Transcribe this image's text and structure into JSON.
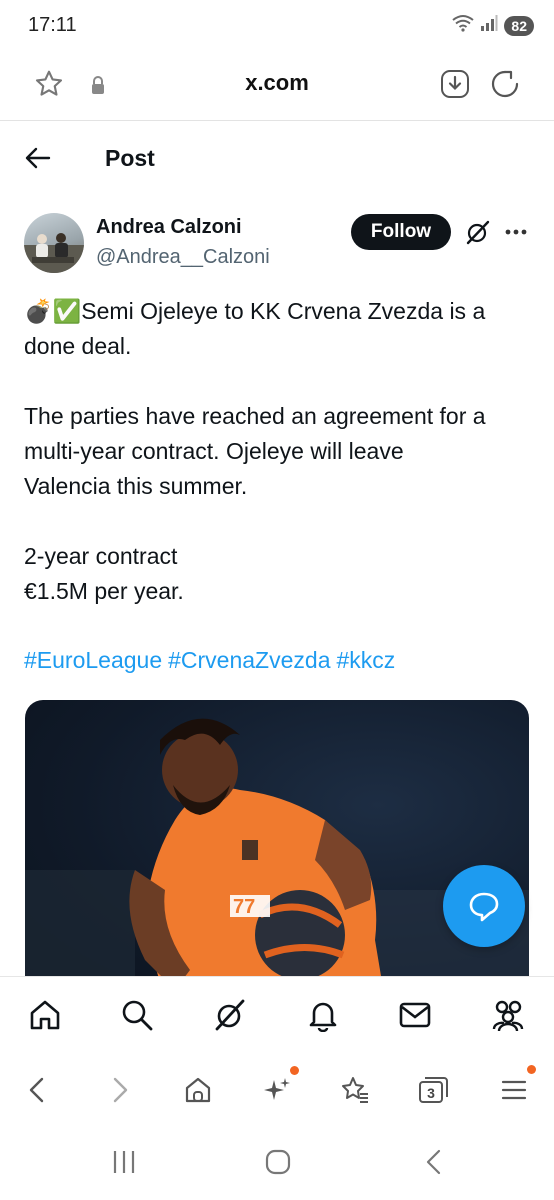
{
  "status": {
    "time": "17:11",
    "battery": "82"
  },
  "browser": {
    "url": "x.com"
  },
  "header": {
    "title": "Post"
  },
  "author": {
    "name": "Andrea Calzoni",
    "handle": "@Andrea__Calzoni"
  },
  "follow_label": "Follow",
  "tweet": {
    "emoji_prefix": "💣✅",
    "text": "Semi Ojeleye to KK Crvena Zvezda is a\ndone deal.\n\nThe parties have reached an agreement for a\nmulti-year contract. Ojeleye will leave\nValencia this summer.\n\n2-year contract\n€1.5M per year.",
    "hashtags": [
      "#EuroLeague",
      "#CrvenaZvezda",
      "#kkcz"
    ]
  },
  "media": {
    "jersey_number": "77"
  },
  "browser_tabs_count": "3",
  "icons": {
    "status": [
      "wifi-icon",
      "signal-icon",
      "battery-icon"
    ],
    "browser_top": [
      "bookmark-star-icon",
      "lock-icon",
      "download-icon",
      "reload-icon"
    ],
    "x_nav": [
      "home-icon",
      "search-icon",
      "grok-icon",
      "notifications-icon",
      "messages-icon",
      "communities-icon"
    ],
    "browser_nav": [
      "back-icon",
      "forward-icon",
      "browser-home-icon",
      "sparkle-icon",
      "bookmarks-icon",
      "tabs-icon",
      "menu-icon"
    ],
    "system_nav": [
      "recents-icon",
      "system-home-icon",
      "system-back-icon"
    ]
  },
  "colors": {
    "accent": "#1d9bf0",
    "text": "#0f1419",
    "muted": "#536471",
    "notify": "#f26522",
    "jersey": "#f07a2e"
  }
}
